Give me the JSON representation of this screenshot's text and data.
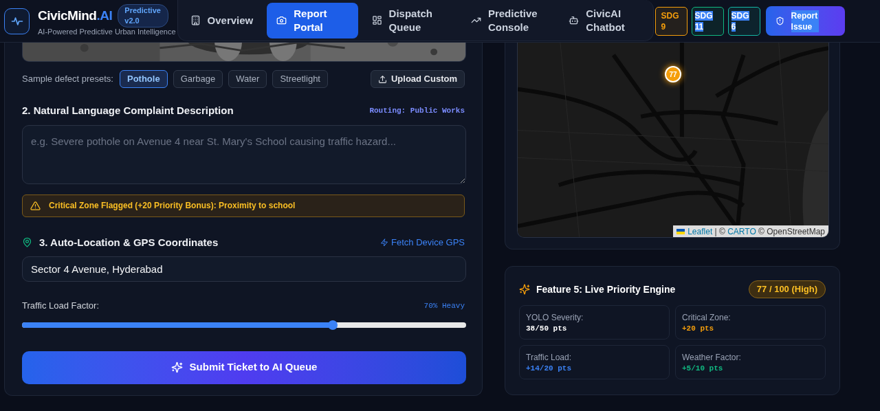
{
  "header": {
    "brand": {
      "name": "CivicMind",
      "suffix": ".AI",
      "tagline": "AI-Powered Predictive Urban Intelligence",
      "version_badge": "Predictive v2.0"
    },
    "nav_tabs": [
      {
        "label": "Overview",
        "selected": false
      },
      {
        "label": "Report Portal",
        "selected": true
      },
      {
        "label": "Dispatch Queue",
        "selected": false
      },
      {
        "label": "Predictive Console",
        "selected": false
      },
      {
        "label": "CivicAI Chatbot",
        "selected": false
      }
    ],
    "sdg_badges": [
      {
        "label": "SDG 9",
        "color": "#f59e0b",
        "text_highlighted": false
      },
      {
        "label": "SDG 11",
        "color": "#10b981",
        "text_highlighted": true
      },
      {
        "label": "SDG 6",
        "color": "#14b8a6",
        "text_highlighted": true
      }
    ],
    "report_button": {
      "label": "Report Issue",
      "text_highlighted": true
    }
  },
  "report_form": {
    "presets_label": "Sample defect presets:",
    "presets": [
      {
        "label": "Pothole",
        "selected": true
      },
      {
        "label": "Garbage",
        "selected": false
      },
      {
        "label": "Water",
        "selected": false
      },
      {
        "label": "Streetlight",
        "selected": false
      }
    ],
    "upload_button": "Upload Custom",
    "description": {
      "heading": "2. Natural Language Complaint Description",
      "routing": "Routing: Public Works",
      "placeholder": "e.g. Severe pothole on Avenue 4 near St. Mary's School causing traffic hazard..."
    },
    "alert": "Critical Zone Flagged (+20 Priority Bonus): Proximity to school",
    "location": {
      "heading": "3. Auto-Location & GPS Coordinates",
      "gps_link": "Fetch Device GPS",
      "value": "Sector 4 Avenue, Hyderabad"
    },
    "traffic": {
      "label": "Traffic Load Factor:",
      "reading": "70% Heavy",
      "level": 0.7
    },
    "submit_button": "Submit Ticket to AI Queue"
  },
  "map": {
    "marker": "77",
    "attribution": {
      "link_1": "Leaflet",
      "text_1": " | © ",
      "link_2": "CARTO",
      "text_2": " © OpenStreetMap"
    }
  },
  "priority_engine": {
    "title": "Feature 5: Live Priority Engine",
    "score": "77 / 100 (High)",
    "factors": [
      {
        "label": "YOLO Severity:",
        "value": "38/50 pts",
        "color": "#ffffff"
      },
      {
        "label": "Critical Zone:",
        "value": "+20 pts",
        "color": "#f59e0b"
      },
      {
        "label": "Traffic Load:",
        "value": "+14/20 pts",
        "color": "#3b82f6"
      },
      {
        "label": "Weather Factor:",
        "value": "+5/10 pts",
        "color": "#10b981"
      }
    ]
  }
}
